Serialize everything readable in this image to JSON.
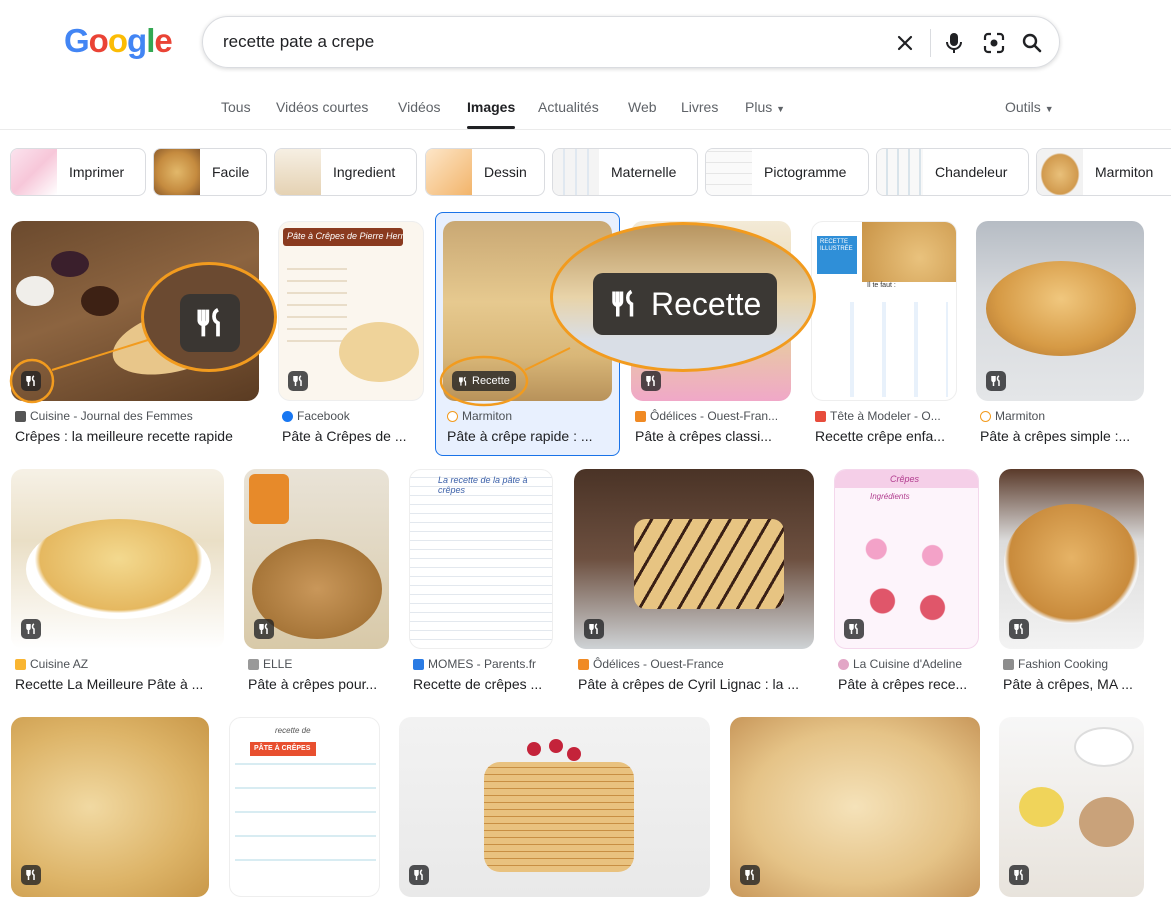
{
  "logo": "Google",
  "search": {
    "query": "recette pate a crepe"
  },
  "tabs": [
    "Tous",
    "Vidéos courtes",
    "Vidéos",
    "Images",
    "Actualités",
    "Web",
    "Livres",
    "Plus"
  ],
  "tools_label": "Outils",
  "chips": [
    "Imprimer",
    "Facile",
    "Ingredient",
    "Dessin",
    "Maternelle",
    "Pictogramme",
    "Chandeleur",
    "Marmiton"
  ],
  "recipe_badge_label": "Recette",
  "zoom_badge_label": "Recette",
  "results": [
    {
      "source": "Cuisine - Journal des Femmes",
      "title": "Crêpes : la meilleure recette rapide"
    },
    {
      "source": "Facebook",
      "title": "Pâte à Crêpes de ..."
    },
    {
      "source": "Marmiton",
      "title": "Pâte à crêpe rapide : ..."
    },
    {
      "source": "Ôdélices - Ouest-Fran...",
      "title": "Pâte à crêpes classi..."
    },
    {
      "source": "Tête à Modeler - O...",
      "title": "Recette crêpe enfa..."
    },
    {
      "source": "Marmiton",
      "title": "Pâte à crêpes simple :..."
    },
    {
      "source": "Cuisine AZ",
      "title": "Recette La Meilleure Pâte à ..."
    },
    {
      "source": "ELLE",
      "title": "Pâte à crêpes pour..."
    },
    {
      "source": "MOMES - Parents.fr",
      "title": "Recette de crêpes ..."
    },
    {
      "source": "Ôdélices - Ouest-France",
      "title": "Pâte à crêpes de Cyril Lignac : la ..."
    },
    {
      "source": "La Cuisine d'Adeline",
      "title": "Pâte à crêpes rece..."
    },
    {
      "source": "Fashion Cooking",
      "title": "Pâte à crêpes, MA ..."
    }
  ],
  "image_text": {
    "pierre_herme": "Pâte à Crêpes de Pierre Hermé",
    "illustrees": "RECETTE ILLUSTRÉE",
    "il_faut": "Il te faut :",
    "momes_title": "La recette de la pâte à crêpes",
    "crepes_title": "Crêpes",
    "ingredients": "Ingrédients",
    "pate_a_crepes": "PÂTE À CRÊPES",
    "recette_de": "recette de"
  },
  "colors": {
    "accent_orange": "#f29b1e",
    "selected_blue": "#1a73e8",
    "selected_bg": "#e8f0fe"
  }
}
